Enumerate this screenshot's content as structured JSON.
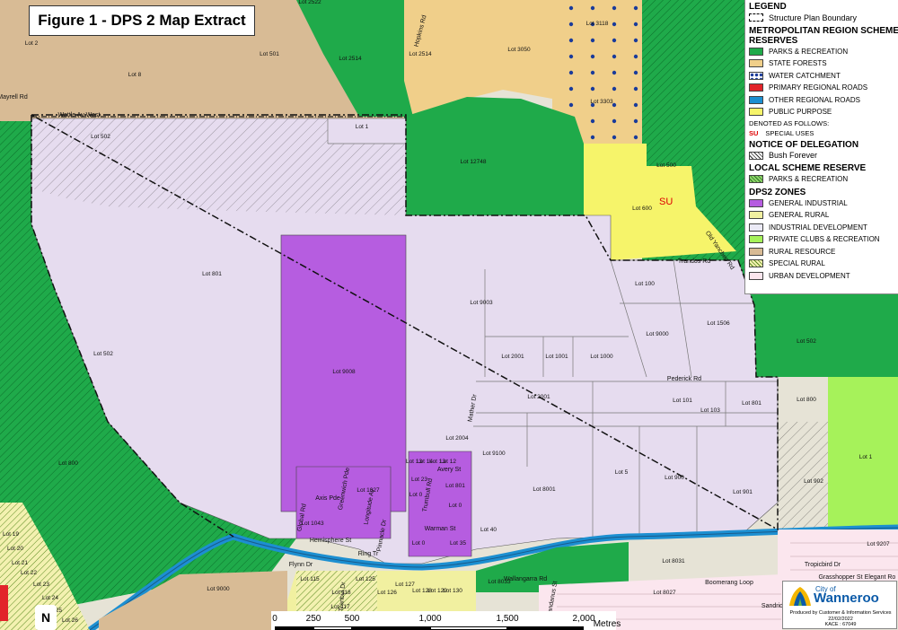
{
  "title": "Figure 1 - DPS 2 Map Extract",
  "legend": {
    "heading": "LEGEND",
    "boundary_label": "Structure Plan Boundary",
    "mrs_heading": "METROPOLITAN REGION SCHEME RESERVES",
    "mrs_items": [
      {
        "label": "PARKS & RECREATION",
        "color": "#1faa4a"
      },
      {
        "label": "STATE FORESTS",
        "color": "#f0cf8a"
      },
      {
        "label": "WATER CATCHMENT",
        "color": "#ffffff"
      },
      {
        "label": "PRIMARY REGIONAL ROADS",
        "color": "#e2232a"
      },
      {
        "label": "OTHER REGIONAL ROADS",
        "color": "#1c8fd1"
      },
      {
        "label": "PUBLIC PURPOSE",
        "color": "#f6f46a"
      }
    ],
    "denoted_label": "DENOTED AS FOLLOWS:",
    "su_code": "SU",
    "su_label": "SPECIAL USES",
    "delegation_heading": "NOTICE OF DELEGATION",
    "bush_forever_label": "Bush Forever",
    "lsr_heading": "LOCAL SCHEME RESERVE",
    "lsr_item": {
      "label": "PARKS & RECREATION",
      "color": "#8ed16a"
    },
    "zones_heading": "DPS2 ZONES",
    "zones": [
      {
        "label": "GENERAL INDUSTRIAL",
        "color": "#b65de0"
      },
      {
        "label": "GENERAL RURAL",
        "color": "#f1f0a0"
      },
      {
        "label": "INDUSTRIAL DEVELOPMENT",
        "color": "#ebeaf6"
      },
      {
        "label": "PRIVATE CLUBS & RECREATION",
        "color": "#a6f25a"
      },
      {
        "label": "RURAL RESOURCE",
        "color": "#d8bb95"
      },
      {
        "label": "SPECIAL RURAL",
        "color": "#f3f1b0"
      },
      {
        "label": "URBAN DEVELOPMENT",
        "color": "#fbe6ee"
      }
    ]
  },
  "map_labels": {
    "lots": [
      "Lot 2522",
      "Lot 2",
      "Lot 8",
      "Lot 501",
      "Lot 2514",
      "Lot 2514",
      "Lot 3050",
      "Lot 3118",
      "Lot 3303",
      "Lot 12748",
      "Lot 502",
      "Lot 1",
      "Lot 500",
      "Lot 600",
      "Lot 801",
      "Lot 502",
      "Lot 9008",
      "Lot 9003",
      "Lot 2001",
      "Lot 1001",
      "Lot 1000",
      "Lot 100",
      "Lot 1506",
      "Lot 9000",
      "Lot 502",
      "Lot 2001",
      "Lot 101",
      "Lot 103",
      "Lot 801",
      "Lot 800",
      "Lot 2004",
      "Lot 9100",
      "Lot 8001",
      "Lot 5",
      "Lot 900",
      "Lot 901",
      "Lot 902",
      "Lot 1",
      "Lot 800",
      "Lot 9000",
      "Lot 40",
      "Lot 9207",
      "Lot 8031",
      "Lot 8033",
      "Lot 8027",
      "Lot 115",
      "Lot 118",
      "Lot 125",
      "Lot 126",
      "Lot 127",
      "Lot 128",
      "Lot 129",
      "Lot 130",
      "Lot 117",
      "Lot 1027",
      "Lot 1043",
      "Lot 19",
      "Lot 20",
      "Lot 21",
      "Lot 22",
      "Lot 23",
      "Lot 24",
      "Lot 25",
      "Lot 26",
      "Lot 13",
      "Lot 14",
      "Lot 13",
      "Lot 12",
      "Lot 23",
      "Lot 801",
      "Lot 0",
      "Lot 0",
      "Lot 0",
      "Lot 35"
    ],
    "roads": [
      "Hopkins Rd",
      "Wattle Av West",
      "Mayrell Rd",
      "Trandos Rd",
      "Old Yanchep Rd",
      "Pederick Rd",
      "Mather Dr",
      "Hemisphere St",
      "Flynn Dr",
      "Avery St",
      "Warman St",
      "Axis Pde",
      "Greenwich Pde",
      "Longitude Av",
      "Global Rd",
      "Trumbull Rd",
      "Pinnacle Dr",
      "Tropicbird Dr",
      "Grasshopper St",
      "Boomerang Loop",
      "Wallangarra Rd",
      "Tranbul Dr",
      "Elegant Ro",
      "Troncap St",
      "Tandanus St",
      "Sandrid",
      "Ring Tr"
    ],
    "su_marker": "SU"
  },
  "north_arrow": "N",
  "scale_bar": {
    "ticks": [
      "0",
      "250",
      "500",
      "1,000",
      "1,500",
      "2,000"
    ],
    "unit": "Metres"
  },
  "city_block": {
    "name_small": "City of",
    "name": "Wanneroo",
    "produced_by": "Produced by Customer & Information Services",
    "date": "22/02/2022",
    "kace": "KACE : 67049"
  }
}
